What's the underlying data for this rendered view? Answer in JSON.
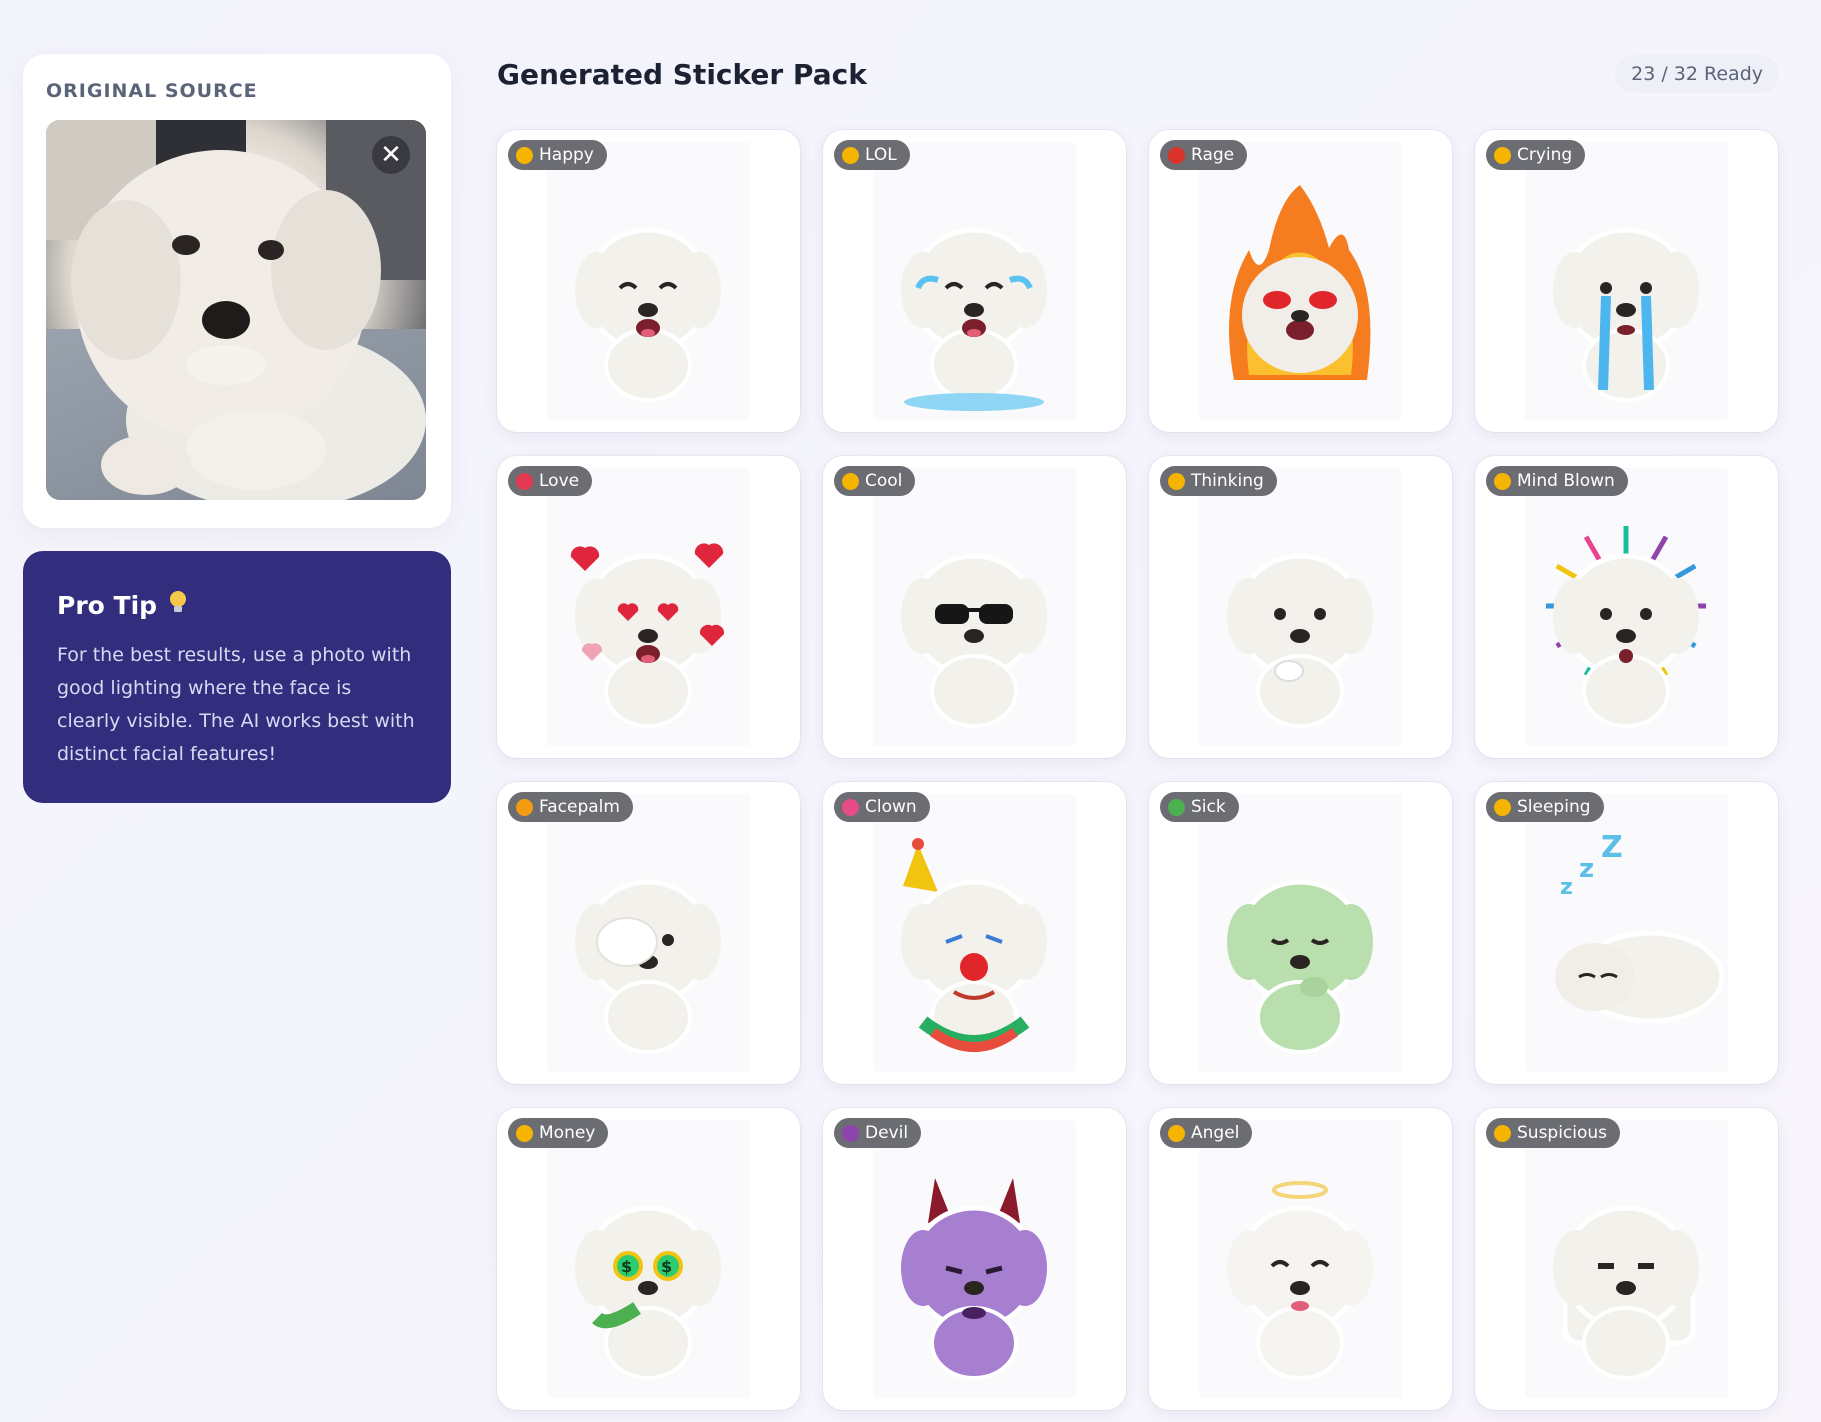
{
  "source": {
    "label": "ORIGINAL SOURCE",
    "close_symbol": "✕"
  },
  "tip": {
    "title": "Pro Tip",
    "icon": "lightbulb-icon",
    "body": "For the best results, use a photo with good lighting where the face is clearly visible. The AI works best with distinct facial features!"
  },
  "main": {
    "title": "Generated Sticker Pack",
    "ready_status": "23 / 32 Ready"
  },
  "stickers": [
    {
      "label": "Happy",
      "icon": "grinning-face-icon",
      "emoji_color": "#f4b400"
    },
    {
      "label": "LOL",
      "icon": "rolling-laughing-face-icon",
      "emoji_color": "#f4b400"
    },
    {
      "label": "Rage",
      "icon": "angry-face-icon",
      "emoji_color": "#d9342b"
    },
    {
      "label": "Crying",
      "icon": "crying-face-icon",
      "emoji_color": "#f4b400"
    },
    {
      "label": "Love",
      "icon": "heart-eyes-face-icon",
      "emoji_color": "#e53952"
    },
    {
      "label": "Cool",
      "icon": "sunglasses-face-icon",
      "emoji_color": "#f4b400"
    },
    {
      "label": "Thinking",
      "icon": "thinking-face-icon",
      "emoji_color": "#f4b400"
    },
    {
      "label": "Mind Blown",
      "icon": "exploding-head-icon",
      "emoji_color": "#f4b400"
    },
    {
      "label": "Facepalm",
      "icon": "facepalm-icon",
      "emoji_color": "#f39c12"
    },
    {
      "label": "Clown",
      "icon": "clown-face-icon",
      "emoji_color": "#e84c88"
    },
    {
      "label": "Sick",
      "icon": "nauseated-face-icon",
      "emoji_color": "#4caf50"
    },
    {
      "label": "Sleeping",
      "icon": "sleeping-face-icon",
      "emoji_color": "#f4b400"
    },
    {
      "label": "Money",
      "icon": "money-mouth-face-icon",
      "emoji_color": "#f4b400"
    },
    {
      "label": "Devil",
      "icon": "smiling-devil-icon",
      "emoji_color": "#8e44ad"
    },
    {
      "label": "Angel",
      "icon": "angel-face-icon",
      "emoji_color": "#f4b400"
    },
    {
      "label": "Suspicious",
      "icon": "suspicious-face-icon",
      "emoji_color": "#f4b400"
    }
  ],
  "colors": {
    "tip_background": "#322d7d",
    "tag_background": "#6b6d72",
    "page_background": "#f4f3fb"
  }
}
